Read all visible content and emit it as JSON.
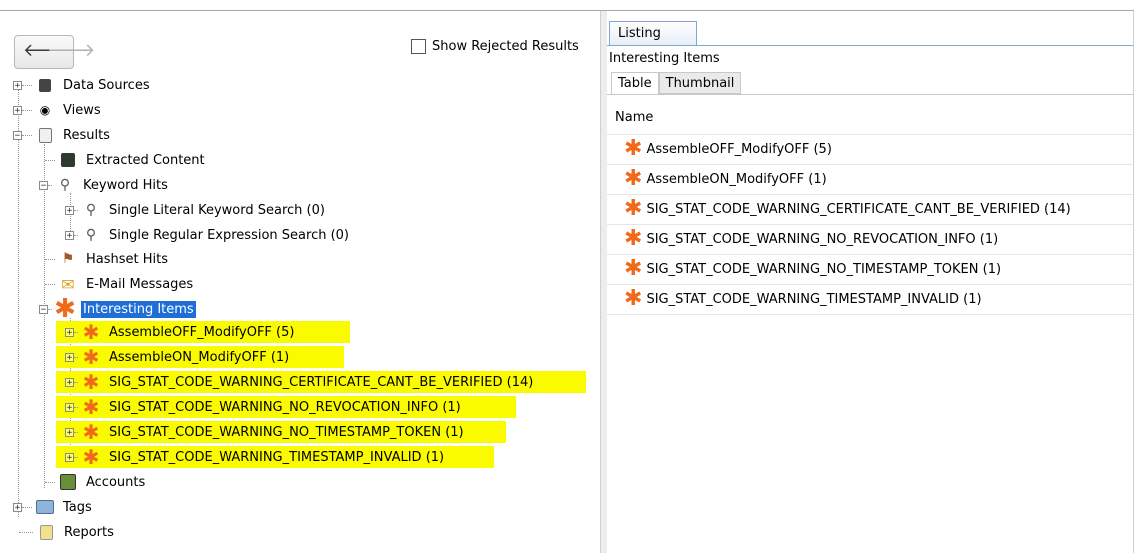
{
  "toolbar": {
    "show_rejected_label": "Show Rejected Results"
  },
  "tree": {
    "data_sources": "Data Sources",
    "views": "Views",
    "results": "Results",
    "extracted_content": "Extracted Content",
    "keyword_hits": "Keyword Hits",
    "single_literal": "Single Literal Keyword Search (0)",
    "single_regex": "Single Regular Expression Search (0)",
    "hashset_hits": "Hashset Hits",
    "email_messages": "E-Mail Messages",
    "interesting_items": "Interesting Items",
    "interesting_children": [
      "AssembleOFF_ModifyOFF (5)",
      "AssembleON_ModifyOFF (1)",
      "SIG_STAT_CODE_WARNING_CERTIFICATE_CANT_BE_VERIFIED (14)",
      "SIG_STAT_CODE_WARNING_NO_REVOCATION_INFO (1)",
      "SIG_STAT_CODE_WARNING_NO_TIMESTAMP_TOKEN (1)",
      "SIG_STAT_CODE_WARNING_TIMESTAMP_INVALID (1)"
    ],
    "accounts": "Accounts",
    "tags": "Tags",
    "reports": "Reports"
  },
  "listing": {
    "tab": "Listing",
    "subtitle": "Interesting Items",
    "tabs": [
      "Table",
      "Thumbnail"
    ],
    "column_name": "Name",
    "rows": [
      "AssembleOFF_ModifyOFF (5)",
      "AssembleON_ModifyOFF (1)",
      "SIG_STAT_CODE_WARNING_CERTIFICATE_CANT_BE_VERIFIED (14)",
      "SIG_STAT_CODE_WARNING_NO_REVOCATION_INFO (1)",
      "SIG_STAT_CODE_WARNING_NO_TIMESTAMP_TOKEN (1)",
      "SIG_STAT_CODE_WARNING_TIMESTAMP_INVALID (1)"
    ]
  },
  "colors": {
    "selection": "#1e6ed6",
    "highlight": "#fbfb00",
    "star": "#f06a1a"
  }
}
